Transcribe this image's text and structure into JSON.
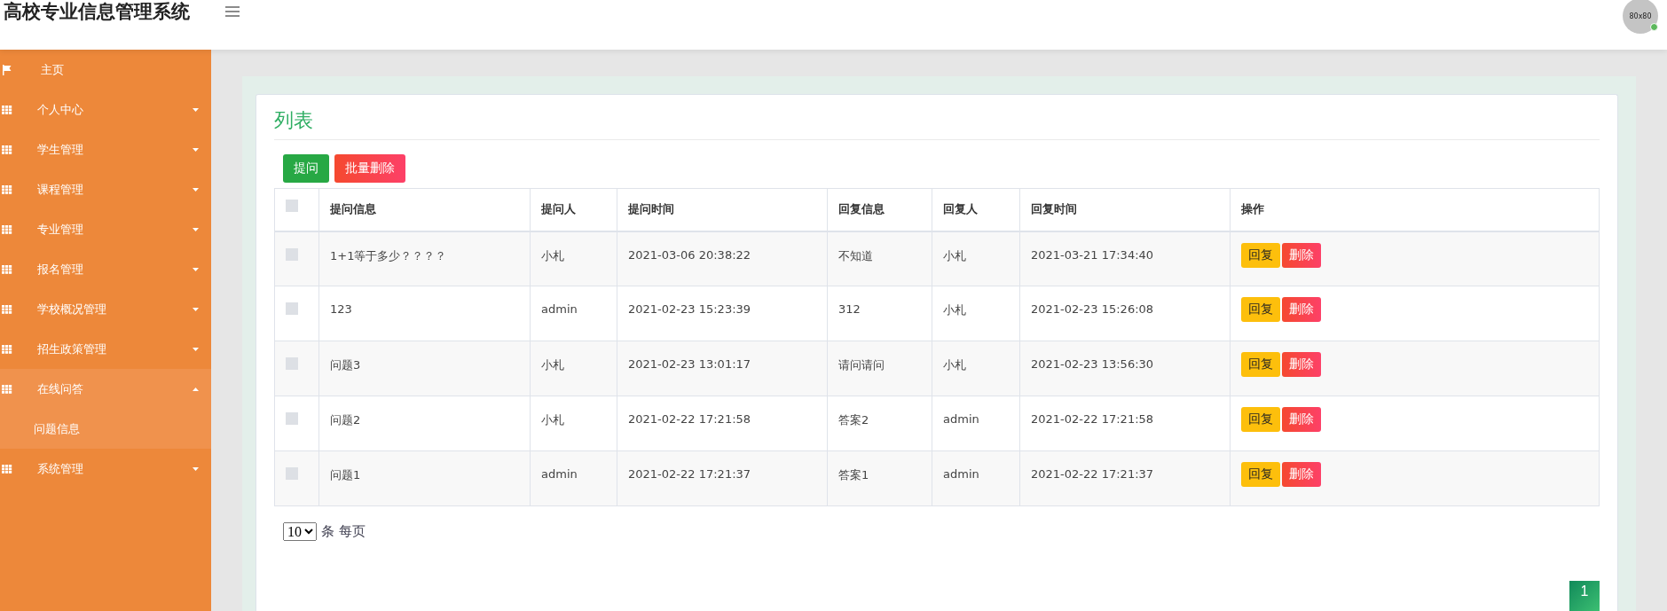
{
  "header": {
    "title": "高校专业信息管理系统",
    "avatar_text": "80x80",
    "online": true
  },
  "sidebar": {
    "items": [
      {
        "kind": "link",
        "label": "主页"
      },
      {
        "kind": "group",
        "label": "个人中心",
        "expanded": false
      },
      {
        "kind": "group",
        "label": "学生管理",
        "expanded": false
      },
      {
        "kind": "group",
        "label": "课程管理",
        "expanded": false
      },
      {
        "kind": "group",
        "label": "专业管理",
        "expanded": false
      },
      {
        "kind": "group",
        "label": "报名管理",
        "expanded": false
      },
      {
        "kind": "group",
        "label": "学校概况管理",
        "expanded": false
      },
      {
        "kind": "group",
        "label": "招生政策管理",
        "expanded": false
      },
      {
        "kind": "group",
        "label": "在线问答",
        "expanded": true,
        "children": [
          {
            "label": "问题信息"
          }
        ]
      },
      {
        "kind": "group",
        "label": "系统管理",
        "expanded": false
      }
    ]
  },
  "panel": {
    "title": "列表",
    "buttons": [
      {
        "kind": "primary",
        "label": "提问"
      },
      {
        "kind": "danger",
        "label": "批量删除"
      }
    ]
  },
  "table": {
    "select_all_checked": false,
    "columns": [
      "提问信息",
      "提问人",
      "提问时间",
      "回复信息",
      "回复人",
      "回复时间",
      "操作"
    ],
    "rows": [
      {
        "checked": false,
        "cells": [
          "1+1等于多少？？？？",
          "小札",
          "2021-03-06 20:38:22",
          "不知道",
          "小札",
          "2021-03-21 17:34:40"
        ],
        "actions": [
          "回复",
          "删除"
        ]
      },
      {
        "checked": false,
        "cells": [
          "123",
          "admin",
          "2021-02-23 15:23:39",
          "312",
          "小札",
          "2021-02-23 15:26:08"
        ],
        "actions": [
          "回复",
          "删除"
        ]
      },
      {
        "checked": false,
        "cells": [
          "问题3",
          "小札",
          "2021-02-23 13:01:17",
          "请问请问",
          "小札",
          "2021-02-23 13:56:30"
        ],
        "actions": [
          "回复",
          "删除"
        ]
      },
      {
        "checked": false,
        "cells": [
          "问题2",
          "小札",
          "2021-02-22 17:21:58",
          "答案2",
          "admin",
          "2021-02-22 17:21:58"
        ],
        "actions": [
          "回复",
          "删除"
        ]
      },
      {
        "checked": false,
        "cells": [
          "问题1",
          "admin",
          "2021-02-22 17:21:37",
          "答案1",
          "admin",
          "2021-02-22 17:21:37"
        ],
        "actions": [
          "回复",
          "删除"
        ]
      }
    ]
  },
  "pagination": {
    "page_size": "10",
    "page_size_suffix": "条 每页",
    "pages": [
      {
        "label": "1",
        "selected": true
      }
    ]
  }
}
